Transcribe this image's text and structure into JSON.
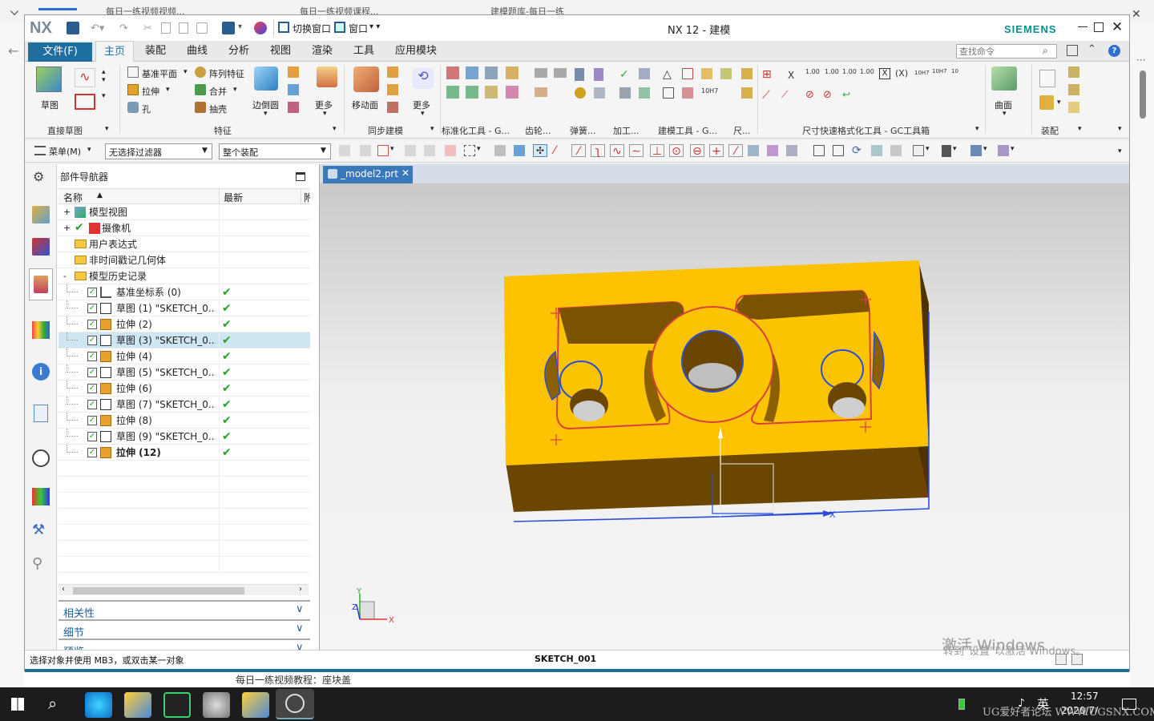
{
  "browser": {
    "tabs": [
      "每日一练视频视频...",
      "每日一练视频课程...",
      "建模题库-每日一练"
    ]
  },
  "window": {
    "title": "NX 12 - 建模",
    "logo": "NX",
    "brand": "SIEMENS",
    "qat": {
      "switch_window": "切换窗口",
      "window_menu": "窗口"
    }
  },
  "menu": {
    "file": "文件(F)",
    "tabs": [
      "主页",
      "装配",
      "曲线",
      "分析",
      "视图",
      "渲染",
      "工具",
      "应用模块"
    ],
    "search_placeholder": "查找命令"
  },
  "ribbon": {
    "sketch": "草图",
    "datum_plane": "基准平面",
    "extrude": "拉伸",
    "hole": "孔",
    "pattern_feature": "阵列特征",
    "unite": "合并",
    "shell": "抽壳",
    "edge_blend": "边倒圆",
    "more1": "更多",
    "move_face": "移动面",
    "more2": "更多",
    "surface": "曲面",
    "groups": [
      "直接草图",
      "特征",
      "同步建模",
      "标准化工具 - G...",
      "齿轮...",
      "弹簧...",
      "加工...",
      "建模工具 - G...",
      "尺...",
      "尺寸快速格式化工具 - GC工具箱",
      "装配"
    ],
    "dim_labels": [
      "1.00",
      "1.00",
      "1.00",
      "1.00",
      "10H7",
      "10H7",
      "10"
    ]
  },
  "selbar": {
    "menu": "菜单(M)",
    "filter": "无选择过滤器",
    "scope": "整个装配"
  },
  "navigator": {
    "title": "部件导航器",
    "col_name": "名称",
    "col_latest": "最新",
    "col_extra": "附",
    "top_rows": [
      {
        "label": "模型视图",
        "expand": "+"
      },
      {
        "label": "摄像机",
        "expand": "+"
      },
      {
        "label": "用户表达式",
        "expand": ""
      },
      {
        "label": "非时间戳记几何体",
        "expand": ""
      },
      {
        "label": "模型历史记录",
        "expand": "-"
      }
    ],
    "history": [
      {
        "label": "基准坐标系 (0)",
        "kind": "datum",
        "ok": "✔"
      },
      {
        "label": "草图 (1) \"SKETCH_0...",
        "kind": "sketch",
        "ok": "✔"
      },
      {
        "label": "拉伸 (2)",
        "kind": "extrude",
        "ok": "✔"
      },
      {
        "label": "草图 (3) \"SKETCH_0...",
        "kind": "sketch",
        "ok": "✔"
      },
      {
        "label": "拉伸 (4)",
        "kind": "extrude",
        "ok": "✔"
      },
      {
        "label": "草图 (5) \"SKETCH_0...",
        "kind": "sketch",
        "ok": "✔"
      },
      {
        "label": "拉伸 (6)",
        "kind": "extrude",
        "ok": "✔"
      },
      {
        "label": "草图 (7) \"SKETCH_0...",
        "kind": "sketch",
        "ok": "✔"
      },
      {
        "label": "拉伸 (8)",
        "kind": "extrude",
        "ok": "✔"
      },
      {
        "label": "草图 (9) \"SKETCH_0...",
        "kind": "sketch",
        "ok": "✔"
      },
      {
        "label": "拉伸 (12)",
        "kind": "extrude",
        "ok": "✔"
      }
    ],
    "panels": [
      "相关性",
      "细节",
      "预览"
    ]
  },
  "viewport": {
    "tab": "_model2.prt",
    "axis_x": "X",
    "axis_y": "Y",
    "axis_z": "Z",
    "watermark_title": "激活 Windows",
    "watermark_sub": "转到\"设置\"以激活 Windows。"
  },
  "status": {
    "hint": "选择对象并使用 MB3，或双击某一对象",
    "center": "SKETCH_001"
  },
  "behind": {
    "caption": "每日一练视频教程：座块盖"
  },
  "taskbar": {
    "ime": "英",
    "time": "12:57",
    "date": "2020/7/",
    "forum_watermark": "UG爱好者论坛 WWW.UGSNX.COM"
  },
  "colors": {
    "nx_blue": "#1e6fa0",
    "part_face": "#ffc200",
    "part_side": "#6b4600",
    "sketch_red": "#d94040",
    "sketch_blue": "#2a4fd6",
    "siemens": "#0a8f8f"
  }
}
